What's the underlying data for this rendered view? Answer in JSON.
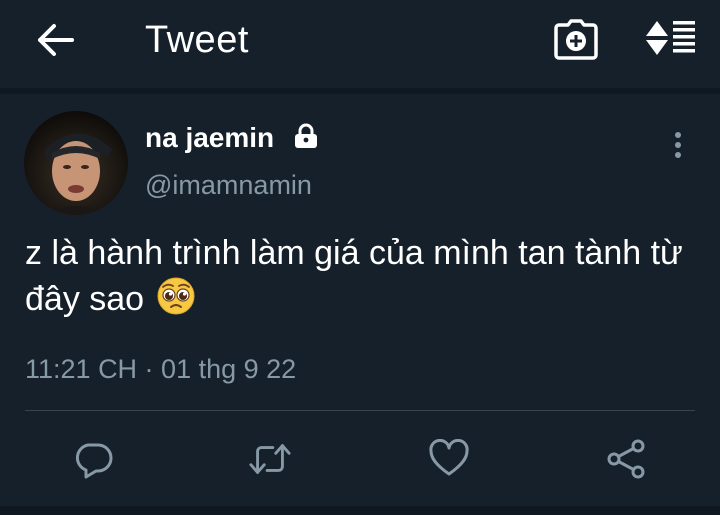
{
  "header": {
    "title": "Tweet",
    "back_icon": "arrow-left-icon",
    "camera_icon": "camera-add-icon",
    "sort_icon": "sort-list-icon"
  },
  "tweet": {
    "display_name": "na jaemin",
    "handle": "@imamnamin",
    "protected_icon": "lock-icon",
    "text": "z là hành trình làm giá của mình tan tành từ đây sao",
    "emoji": "pleading-face-emoji",
    "timestamp": "11:21 CH · 01 thg 9 22"
  },
  "actions": [
    {
      "icon": "reply-icon"
    },
    {
      "icon": "retweet-icon"
    },
    {
      "icon": "like-icon"
    },
    {
      "icon": "share-icon"
    }
  ],
  "colors": {
    "background": "#15202b",
    "text_primary": "#ffffff",
    "text_secondary": "#8899a6",
    "divider": "#38444d"
  }
}
